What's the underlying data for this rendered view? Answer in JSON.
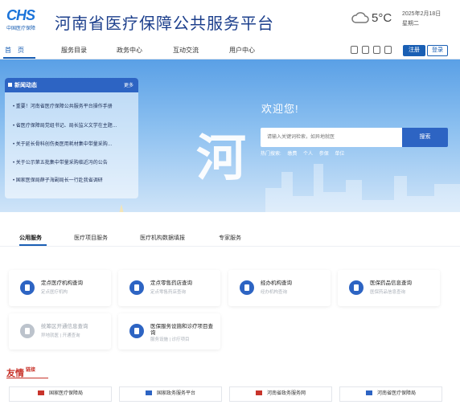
{
  "header": {
    "logo_text": "CHS",
    "logo_sub": "中国医疗保障",
    "title": "河南省医疗保障公共服务平台",
    "weather_icon": "cloud-icon",
    "temperature": "5°C",
    "date": "2025年2月18日",
    "weekday": "星期二"
  },
  "nav": {
    "items": [
      "首　页",
      "服务目录",
      "政务中心",
      "互动交流",
      "用户中心"
    ],
    "register": "注册",
    "login": "登录"
  },
  "news": {
    "title": "新闻动态",
    "more": "更多",
    "items": [
      "重要！河南省医疗保障公共服务平台操作手册",
      "省医疗保障局党组书记、局长监义文学在主题…",
      "关于延长骨科创伤类医用耗材集中带量采购…",
      "关于公示第五批集中带量采购临近冯的公告",
      "国家医保局薛子海副局长一行赴我省调研"
    ]
  },
  "hero": {
    "welcome": "欢迎您!",
    "calligraphy": "河",
    "search_placeholder": "请输入关键词检索，如异地就医",
    "search_button": "搜索",
    "hot_label": "热门搜索:",
    "hot_terms": [
      "缴费",
      "个人",
      "参保",
      "单位"
    ]
  },
  "tabs": [
    "公用服务",
    "医疗项目服务",
    "医疗机构数据填报",
    "专家服务"
  ],
  "cards": [
    {
      "title": "定点医疗机构查询",
      "sub": "定点医疗机构",
      "icon": "hospital-plus-icon",
      "enabled": true
    },
    {
      "title": "定点零售药店查询",
      "sub": "定点零售药店查询",
      "icon": "pharmacy-icon",
      "enabled": true
    },
    {
      "title": "经办机构查询",
      "sub": "经办机构查询",
      "icon": "home-icon",
      "enabled": true
    },
    {
      "title": "医保药品信息查询",
      "sub": "医保药品信息查询",
      "icon": "medicine-bottle-icon",
      "enabled": true
    },
    {
      "title": "统筹区开通信息查询",
      "sub": "异地就医 | 开通查询",
      "icon": "document-icon",
      "enabled": false
    },
    {
      "title": "医保服务设施和诊疗项目查询",
      "sub": "服务设施 | 诊疗项目",
      "icon": "network-icon",
      "enabled": true
    }
  ],
  "friend_links": {
    "title_a": "友情",
    "title_b": "链接",
    "items": [
      {
        "label": "国家医疗保障局",
        "icon": "emblem-icon"
      },
      {
        "label": "国家政务服务平台",
        "icon": "flag-icon"
      },
      {
        "label": "河南省政务服务网",
        "icon": "emblem-icon"
      },
      {
        "label": "河南省医疗保障局",
        "icon": "flag-icon"
      }
    ]
  }
}
